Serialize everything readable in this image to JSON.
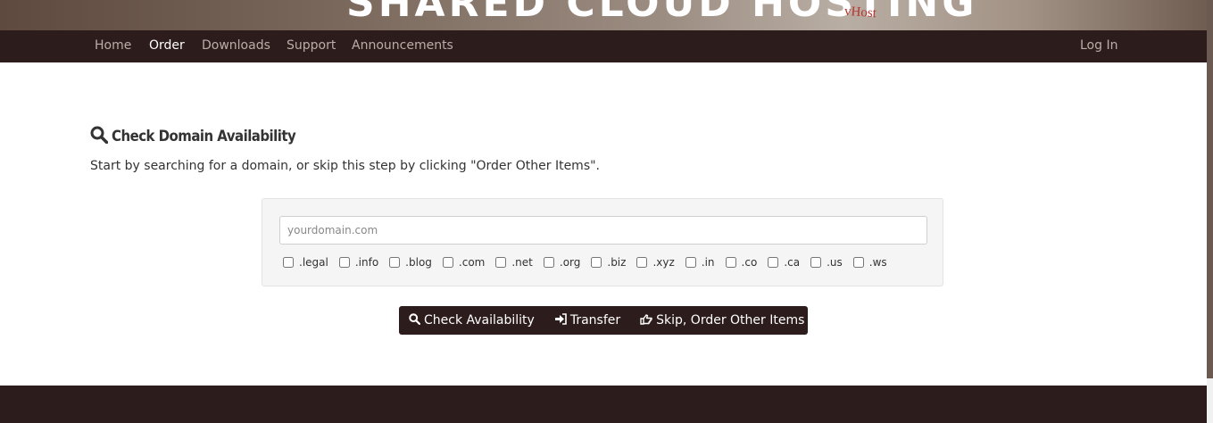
{
  "banner": {
    "title": "SHARED CLOUD HOSTING",
    "logo_text": "vHost"
  },
  "nav": {
    "items": [
      {
        "label": "Home"
      },
      {
        "label": "Order"
      },
      {
        "label": "Downloads"
      },
      {
        "label": "Support"
      },
      {
        "label": "Announcements"
      }
    ],
    "login": "Log In"
  },
  "heading": {
    "icon": "search-icon",
    "title": "Check Domain Availability"
  },
  "subtext": "Start by searching for a domain, or skip this step by clicking \"Order Other Items\".",
  "search": {
    "placeholder": "yourdomain.com",
    "value": "",
    "tlds": [
      ".legal",
      ".info",
      ".blog",
      ".com",
      ".net",
      ".org",
      ".biz",
      ".xyz",
      ".in",
      ".co",
      ".ca",
      ".us",
      ".ws"
    ]
  },
  "buttons": {
    "check": {
      "label": "Check Availability",
      "icon": "search-icon"
    },
    "transfer": {
      "label": "Transfer",
      "icon": "sign-in-icon"
    },
    "skip": {
      "label": "Skip, Order Other Items",
      "icon": "hand-pointer-icon"
    }
  },
  "colors": {
    "nav_bg": "#2d1c1c",
    "active_nav": "#ffffff",
    "inactive_nav": "#b9aea8"
  }
}
